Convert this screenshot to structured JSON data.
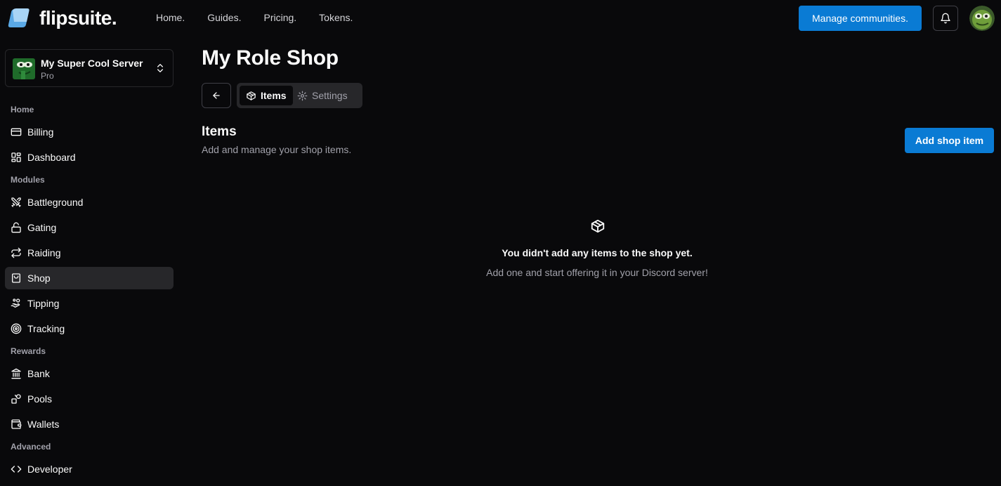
{
  "brand": {
    "name": "flipsuite."
  },
  "topnav": {
    "links": [
      "Home.",
      "Guides.",
      "Pricing.",
      "Tokens."
    ],
    "manage_label": "Manage communities."
  },
  "server": {
    "name": "My Super Cool Server",
    "plan": "Pro"
  },
  "sidebar": {
    "sections": {
      "home": "Home",
      "modules": "Modules",
      "rewards": "Rewards",
      "advanced": "Advanced"
    },
    "items": {
      "billing": "Billing",
      "dashboard": "Dashboard",
      "battleground": "Battleground",
      "gating": "Gating",
      "raiding": "Raiding",
      "shop": "Shop",
      "tipping": "Tipping",
      "tracking": "Tracking",
      "bank": "Bank",
      "pools": "Pools",
      "wallets": "Wallets",
      "developer": "Developer"
    },
    "active": "shop"
  },
  "main": {
    "title": "My Role Shop",
    "tabs": {
      "items": "Items",
      "settings": "Settings"
    },
    "section_title": "Items",
    "section_desc": "Add and manage your shop items.",
    "add_label": "Add shop item",
    "empty_title": "You didn't add any items to the shop yet.",
    "empty_desc": "Add one and start offering it in your Discord server!"
  },
  "colors": {
    "accent": "#0a7bd4",
    "background": "#09090b",
    "active_item": "#27272a",
    "muted_text": "#a1a1aa"
  },
  "icons": {
    "brand": "flipsuite-logo-icon",
    "bell": "bell-icon",
    "back": "arrow-left-icon",
    "items_tab": "package-icon",
    "settings_tab": "gear-icon",
    "empty": "package-icon"
  }
}
